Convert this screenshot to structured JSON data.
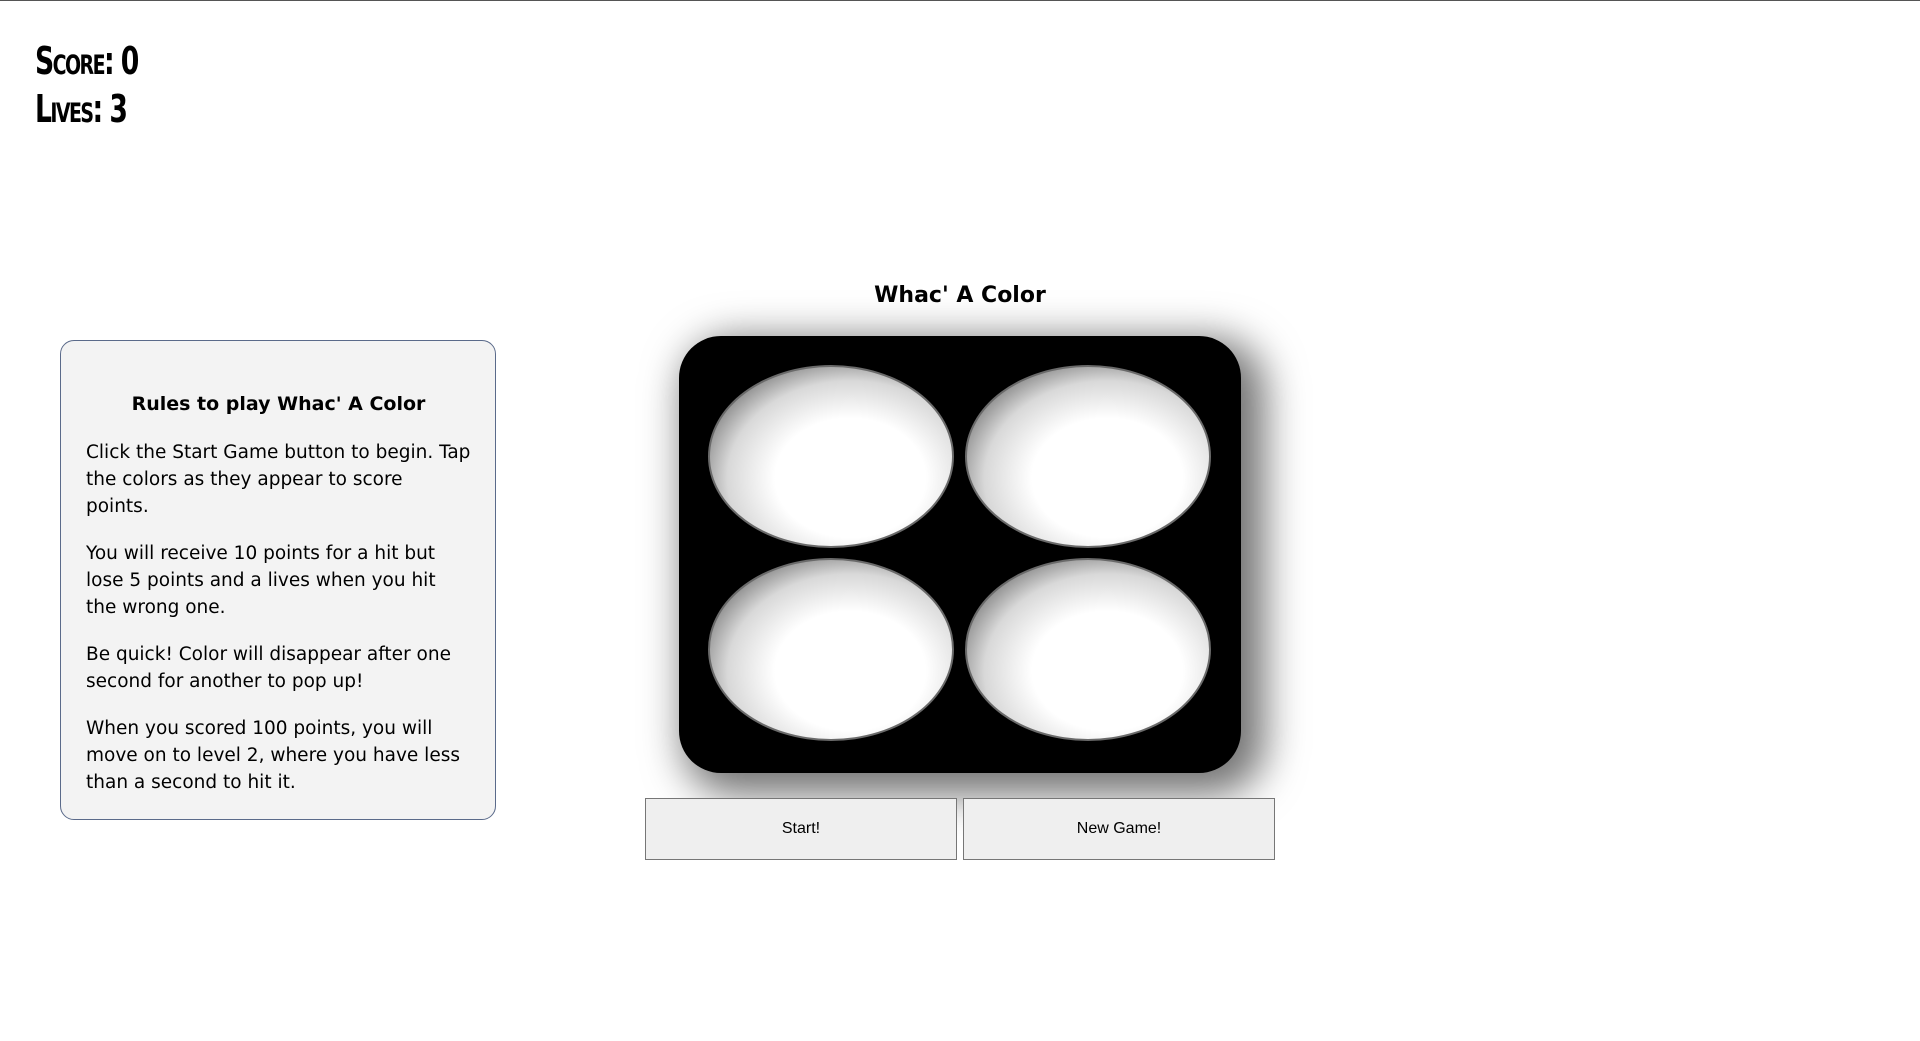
{
  "stats": {
    "score_label": "Score: 0",
    "lives_label": "Lives: 3"
  },
  "rules": {
    "title": "Rules to play Whac' A Color",
    "paragraphs": [
      "Click the Start Game button to begin. Tap the colors as they appear to score points.",
      "You will receive 10 points for a hit but lose 5 points and a lives when you hit the wrong one.",
      "Be quick! Color will disappear after one second for another to pop up!",
      "When you scored 100 points, you will move on to level 2, where you have less than a second to hit it."
    ]
  },
  "game": {
    "title": "Whac' A Color",
    "holes": 4
  },
  "buttons": {
    "start": "Start!",
    "new_game": "New Game!"
  }
}
